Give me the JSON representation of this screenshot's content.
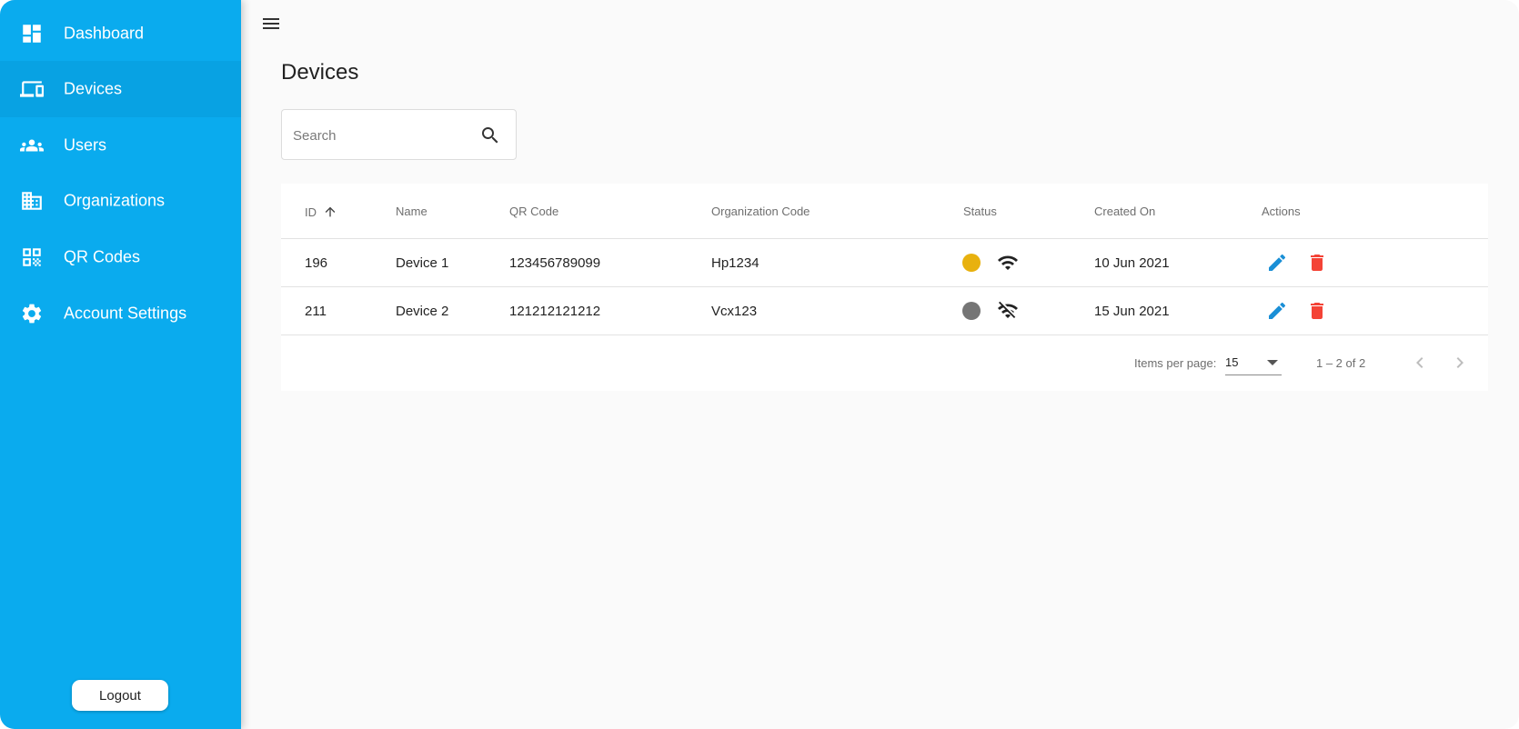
{
  "sidebar": {
    "items": [
      {
        "label": "Dashboard",
        "icon": "dashboard-icon"
      },
      {
        "label": "Devices",
        "icon": "devices-icon",
        "active": true
      },
      {
        "label": "Users",
        "icon": "users-icon"
      },
      {
        "label": "Organizations",
        "icon": "organization-icon"
      },
      {
        "label": "QR Codes",
        "icon": "qr-code-icon"
      },
      {
        "label": "Account Settings",
        "icon": "gear-icon"
      }
    ],
    "logout_label": "Logout",
    "bg_color": "#0aabee"
  },
  "header": {
    "menu_icon": "hamburger-menu-icon"
  },
  "main": {
    "title": "Devices",
    "search": {
      "placeholder": "Search",
      "value": ""
    },
    "table": {
      "columns": {
        "id": "ID",
        "name": "Name",
        "qr": "QR Code",
        "org": "Organization Code",
        "status": "Status",
        "created": "Created On",
        "actions": "Actions"
      },
      "sort": {
        "column": "ID",
        "direction": "ascending"
      },
      "rows": [
        {
          "id": "196",
          "name": "Device 1",
          "qr": "123456789099",
          "org": "Hp1234",
          "status_color": "#e8b10e",
          "wifi": "wifi-icon",
          "created": "10 Jun 2021"
        },
        {
          "id": "211",
          "name": "Device 2",
          "qr": "121212121212",
          "org": "Vcx123",
          "status_color": "#757575",
          "wifi": "wifi-off-icon",
          "created": "15 Jun 2021"
        }
      ]
    },
    "paginator": {
      "items_per_page_label": "Items per page:",
      "items_per_page": "15",
      "range": "1 – 2 of 2"
    }
  },
  "colors": {
    "edit": "#1a8fd6",
    "delete": "#f44336"
  }
}
